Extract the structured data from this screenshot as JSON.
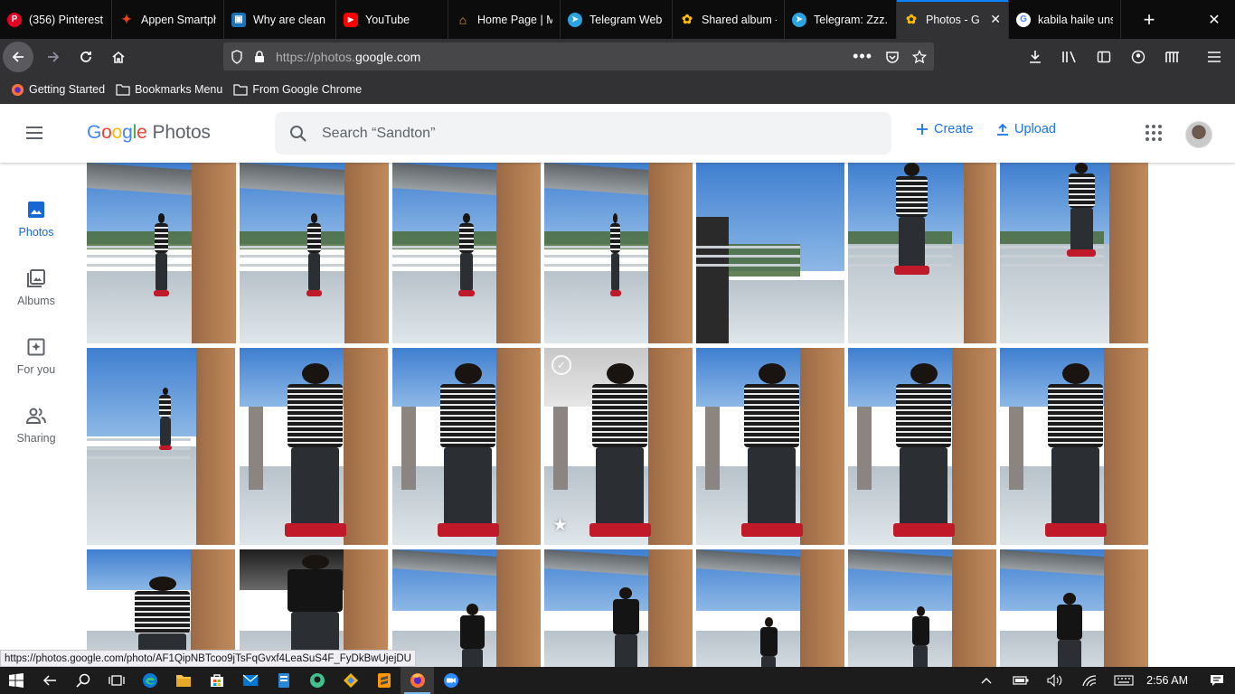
{
  "browser": {
    "tabs": [
      {
        "title": "(356) Pinterest",
        "icon": "pinterest-icon",
        "color": "#e60023",
        "glyph": "P"
      },
      {
        "title": "Appen Smartph",
        "icon": "appen-icon",
        "color": "#e8431f",
        "glyph": "✦"
      },
      {
        "title": "Why are clean r",
        "icon": "page-icon",
        "color": "#1a73b8",
        "glyph": "▣"
      },
      {
        "title": "YouTube",
        "icon": "youtube-icon",
        "color": "#ff0000",
        "glyph": "▶"
      },
      {
        "title": "Home Page | M",
        "icon": "home-page-icon",
        "color": "#e8a21f",
        "glyph": "⌂"
      },
      {
        "title": "Telegram Web",
        "icon": "telegram-icon",
        "color": "#2aa3e0",
        "glyph": "➤"
      },
      {
        "title": "Shared album -",
        "icon": "google-photos-icon",
        "color": "#fbbc05",
        "glyph": "✿"
      },
      {
        "title": "Telegram: Zzz...",
        "icon": "telegram-icon",
        "color": "#2aa3e0",
        "glyph": "➤"
      },
      {
        "title": "Photos - G",
        "icon": "google-photos-icon",
        "color": "#fbbc05",
        "glyph": "✿",
        "active": true
      },
      {
        "title": "kabila haile uns",
        "icon": "google-icon",
        "color": "#ffffff",
        "glyph": "G"
      }
    ],
    "url_prefix": "https://photos.",
    "url_domain": "google.com",
    "bookmarks": [
      {
        "label": "Getting Started",
        "icon": "firefox-icon"
      },
      {
        "label": "Bookmarks Menu",
        "icon": "folder-icon"
      },
      {
        "label": "From Google Chrome",
        "icon": "folder-icon"
      }
    ],
    "status_link": "https://photos.google.com/photo/AF1QipNBTcoo9jTsFqGvxf4LeaSuS4F_FyDkBwUjejDU"
  },
  "app": {
    "logo_google": [
      "G",
      "o",
      "o",
      "g",
      "l",
      "e"
    ],
    "logo_product": "Photos",
    "search_placeholder": "Search “Sandton”",
    "create_label": "Create",
    "upload_label": "Upload",
    "accent": "#1a73e8"
  },
  "sidenav": [
    {
      "label": "Photos",
      "icon": "photos-icon",
      "active": true
    },
    {
      "label": "Albums",
      "icon": "albums-icon"
    },
    {
      "label": "For you",
      "icon": "for-you-icon"
    },
    {
      "label": "Sharing",
      "icon": "sharing-icon"
    }
  ],
  "taskbar": {
    "clock": "2:56 AM",
    "apps": [
      "start-icon",
      "back-icon",
      "search-icon",
      "task-view-icon",
      "edge-icon",
      "file-explorer-icon",
      "store-icon",
      "mail-icon",
      "office-icon",
      "kobo-icon",
      "colorful-app-icon",
      "sublime-icon",
      "firefox-icon",
      "zoom-icon"
    ]
  }
}
